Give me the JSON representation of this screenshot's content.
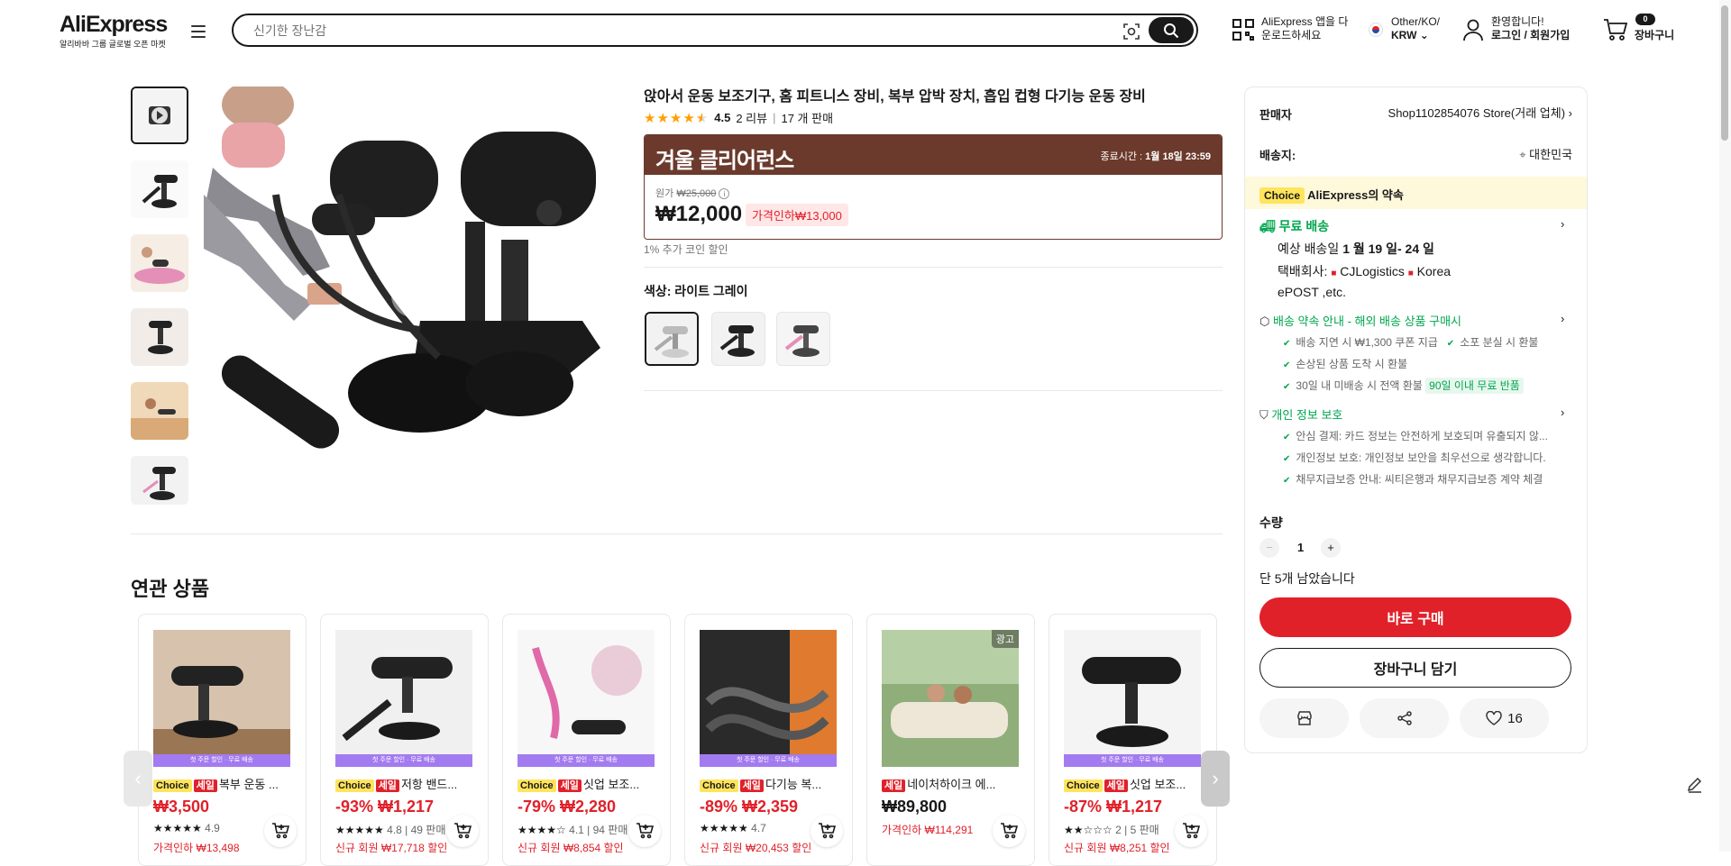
{
  "header": {
    "logo": "AliExpress",
    "logo_sub": "알리바바 그룹 글로벌 오픈 마켓",
    "search_placeholder": "신기한 장난감",
    "app_line1": "AliExpress 앱을 다",
    "app_line2": "운로드하세요",
    "region_line1": "Other/KO/",
    "region_line2": "KRW",
    "account_line1": "환영합니다!",
    "account_line2": "로그인 / 회원가입",
    "cart_count": "0",
    "cart_label": "장바구니"
  },
  "product": {
    "title": "앉아서 운동 보조기구, 홈 피트니스 장비, 복부 압박 장치, 흡입 컵형 다기능 운동 장비",
    "rating": "4.5",
    "reviews": "2 리뷰",
    "sold": "17 개 판매",
    "star_fraction": 0.9,
    "promo_title": "겨울 클리어런스",
    "promo_end_label": "종료시간 :",
    "promo_end_time": "1월 18일 23:59",
    "original_label": "원가",
    "original_price": "₩25,000",
    "price": "₩12,000",
    "discount": "가격인하₩13,000",
    "coin_note": "1% 추가 코인 할인",
    "color_label": "색상: 라이트 그레이"
  },
  "panel": {
    "seller_label": "판매자",
    "seller_name": "Shop1102854076 Store(거래 업체)",
    "ship_to_label": "배송지:",
    "ship_to": "대한민국",
    "choice_tag": "Choice",
    "choice_text": "AliExpress의 약속",
    "free_ship": "무료 배송",
    "est_label": "예상 배송일",
    "est_dates": "1 월 19 일- 24 일",
    "carrier_label": "택배회사:",
    "carrier_a": "CJLogistics",
    "carrier_b": "Korea",
    "carrier_c": "ePOST ,etc.",
    "guarantee_title": "배송 약속 안내 - 해외 배송 상품 구매시",
    "g1": "배송 지연 시 ₩1,300 쿠폰 지급",
    "g2": "소포 분실 시 환불",
    "g3": "손상된 상품 도착 시 환불",
    "g4": "30일 내 미배송 시 전액 환불",
    "g4_badge": "90일 이내 무료 반품",
    "privacy_title": "개인 정보 보호",
    "p1": "안심 결제: 카드 정보는 안전하게 보호되며 유출되지 않...",
    "p2": "개인정보 보호: 개인정보 보안을 최우선으로 생각합니다.",
    "p3": "채무지급보증 안내: 씨티은행과 채무지급보증 계약 체결",
    "qty_label": "수량",
    "qty_value": "1",
    "stock_note": "단 5개 남았습니다",
    "buy_now": "바로 구매",
    "add_cart": "장바구니 담기",
    "wish_count": "16"
  },
  "related": {
    "title": "연관 상품",
    "band_text": "첫 주문 할인 · 무료 배송",
    "ad_badge": "광고",
    "items": [
      {
        "choice": "Choice",
        "sale": "세일",
        "name": "복부 운동 ...",
        "price": "₩3,500",
        "rating": "4.9",
        "note": "가격인하 ₩13,498"
      },
      {
        "choice": "Choice",
        "sale": "세일",
        "name": "저항 밴드...",
        "price": "-93% ₩1,217",
        "rating": "4.8 | 49 판매",
        "note": "신규 회원 ₩17,718 할인"
      },
      {
        "choice": "Choice",
        "sale": "세일",
        "name": "싯업 보조...",
        "price": "-79% ₩2,280",
        "rating": "4.1 | 94 판매",
        "note": "신규 회원 ₩8,854 할인"
      },
      {
        "choice": "Choice",
        "sale": "세일",
        "name": "다기능 복...",
        "price": "-89% ₩2,359",
        "rating": "4.7",
        "note": "신규 회원 ₩20,453 할인"
      },
      {
        "choice": "",
        "sale": "세일",
        "name": "네이처하이크 에...",
        "price": "₩89,800",
        "rating": "",
        "note": "가격인하 ₩114,291"
      },
      {
        "choice": "Choice",
        "sale": "세일",
        "name": "싯업 보조...",
        "price": "-87% ₩1,217",
        "rating": "2 | 5 판매",
        "note": "신규 회원 ₩8,251 할인"
      }
    ]
  },
  "colors": {
    "brand_red": "#e0212a",
    "promo_brown": "#6b3a2c",
    "choice_yellow": "#ffe45c",
    "green": "#00a64e"
  }
}
